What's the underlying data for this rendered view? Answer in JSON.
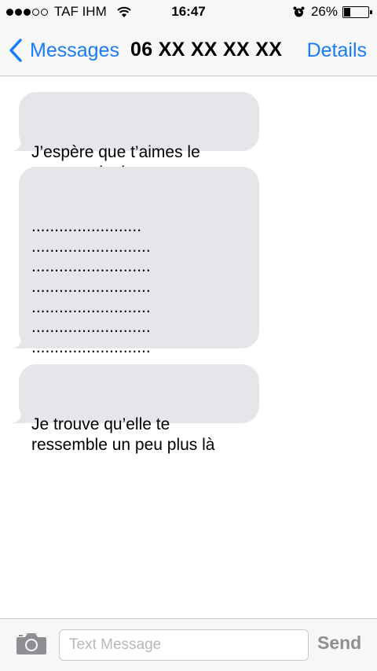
{
  "status_bar": {
    "signal_dots_filled": 3,
    "signal_dots_total": 5,
    "carrier": "TAF IHM",
    "time": "16:47",
    "battery_percent": "26%",
    "battery_level": 0.26,
    "icons": [
      "wifi-icon",
      "alarm-icon",
      "battery-icon"
    ]
  },
  "nav": {
    "back_label": "Messages",
    "title": "06 XX XX XX XX",
    "details_label": "Details",
    "accent_color": "#1a7cf5"
  },
  "messages": [
    {
      "direction": "received",
      "text": "J’espère que t’aimes le\nnouveau look"
    },
    {
      "direction": "received",
      "text": "........................\n..........................\n..........................\n..........................\n..........................\n..........................\n..........................\n............................"
    },
    {
      "direction": "received",
      "text": "Je trouve qu’elle te\nressemble un peu plus là"
    }
  ],
  "input_bar": {
    "placeholder": "Text Message",
    "value": "",
    "send_label": "Send"
  },
  "colors": {
    "received_bubble": "#e5e5ea",
    "bar_background": "#f7f7f7",
    "send_disabled": "#8e8e93"
  }
}
